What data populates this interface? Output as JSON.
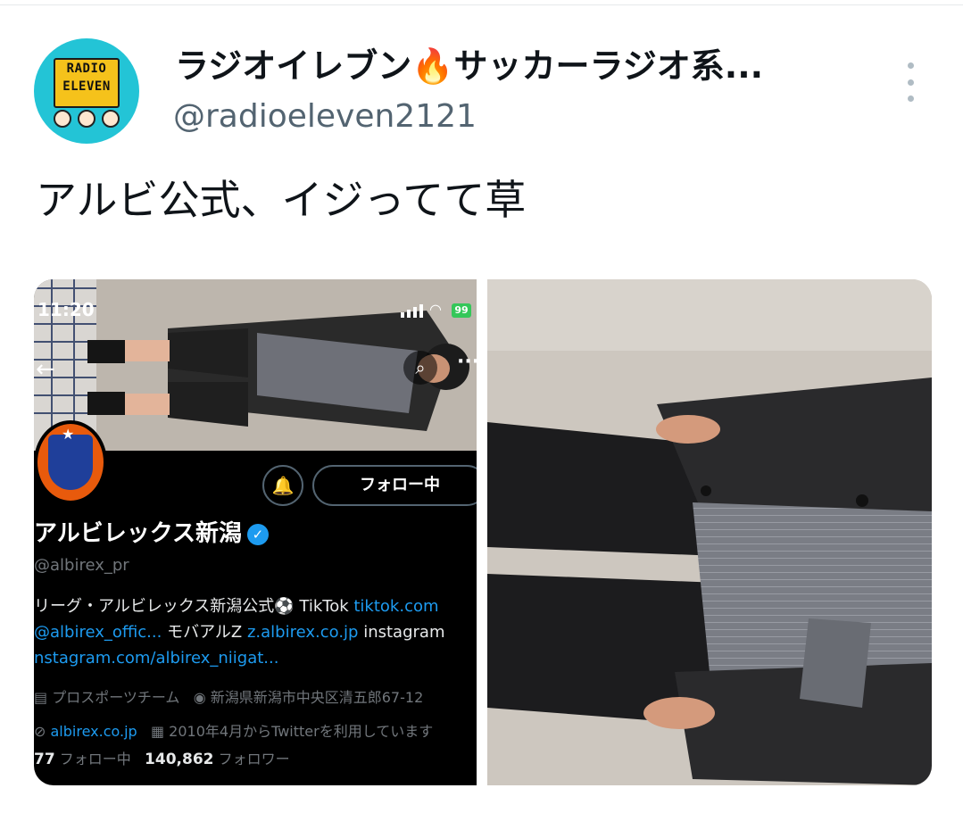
{
  "tweet": {
    "author_name": "ラジオイレブン🔥サッカーラジオ系...",
    "author_handle": "@radioeleven2121",
    "avatar_sign_line1": "RADIO",
    "avatar_sign_line2": "ELEVEN",
    "text": "アルビ公式、イジってて草"
  },
  "embedded_screenshot": {
    "time": "11:20",
    "battery": "99",
    "follow_button": "フォロー中",
    "account_name": "アルビレックス新潟",
    "account_handle": "@albirex_pr",
    "bio_line1_text": "リーグ・アルビレックス新潟公式⚽ TikTok ",
    "bio_line1_link": "tiktok.com",
    "bio_line2_link1": "@albirex_offic...",
    "bio_line2_text": " モバアルZ ",
    "bio_line2_link2": "z.albirex.co.jp",
    "bio_line2_text2": " instagram",
    "bio_line3_link": "nstagram.com/albirex_niigat...",
    "category": "プロスポーツチーム",
    "location": "新潟県新潟市中央区清五郎67-12",
    "website": "albirex.co.jp",
    "joined": "2010年4月からTwitterを利用しています",
    "following_count": "77",
    "following_label": "フォロー中",
    "followers_count": "140,862",
    "followers_label": "フォロワー"
  },
  "colors": {
    "accent": "#1d9bf0",
    "handle_gray": "#536471",
    "dark_bg": "#000000"
  }
}
